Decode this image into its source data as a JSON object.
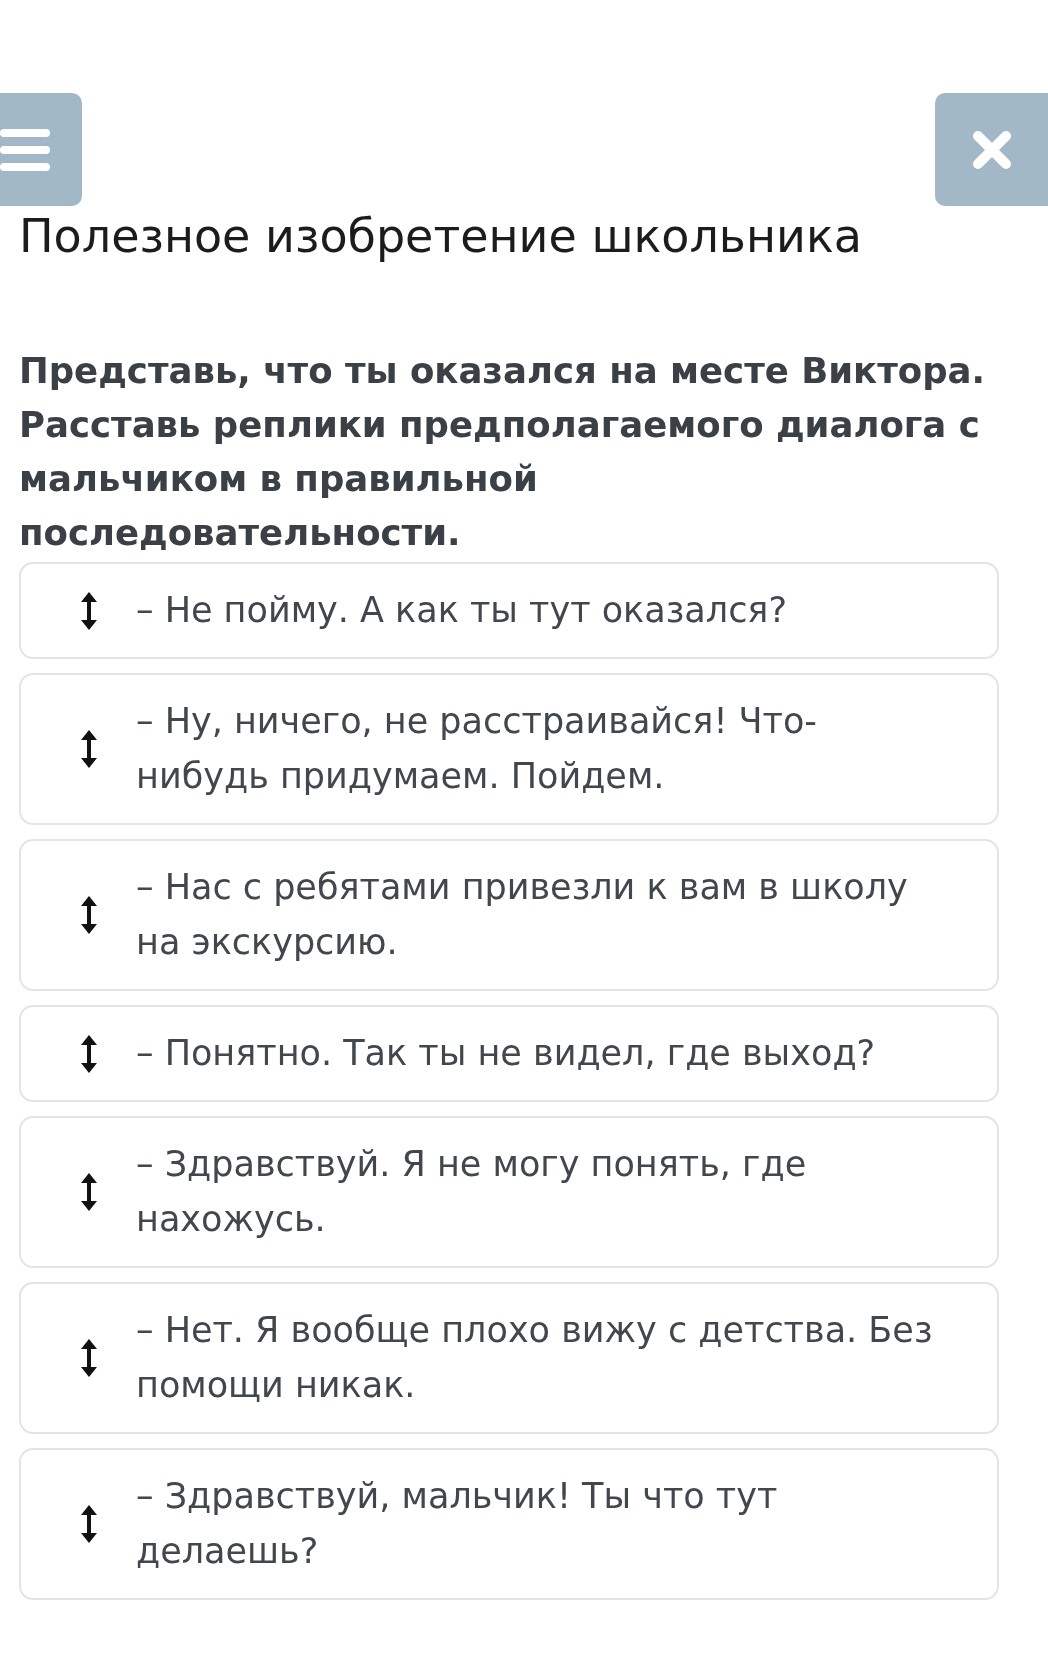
{
  "title": "Полезное изобретение школьника",
  "question": {
    "lines": [
      "Представь, что ты оказался на месте Виктора.",
      "Расставь реплики предполагаемого диалога с",
      "мальчиком в правильной",
      "последовательности."
    ]
  },
  "answers": [
    {
      "lines": [
        "– Не пойму. А как ты тут оказался?"
      ]
    },
    {
      "lines": [
        "– Ну, ничего, не расстраивайся! Что-",
        "нибудь придумаем. Пойдем."
      ]
    },
    {
      "lines": [
        "– Нас с ребятами привезли к вам в школу",
        "на экскурсию."
      ]
    },
    {
      "lines": [
        "– Понятно. Так ты не видел, где выход?"
      ]
    },
    {
      "lines": [
        "– Здравствуй. Я не могу понять, где",
        "нахожусь."
      ]
    },
    {
      "lines": [
        "– Нет. Я вообще плохо вижу с детства. Без",
        "помощи никак."
      ]
    },
    {
      "lines": [
        "– Здравствуй, мальчик! Ты что тут",
        "делаешь?"
      ]
    }
  ]
}
